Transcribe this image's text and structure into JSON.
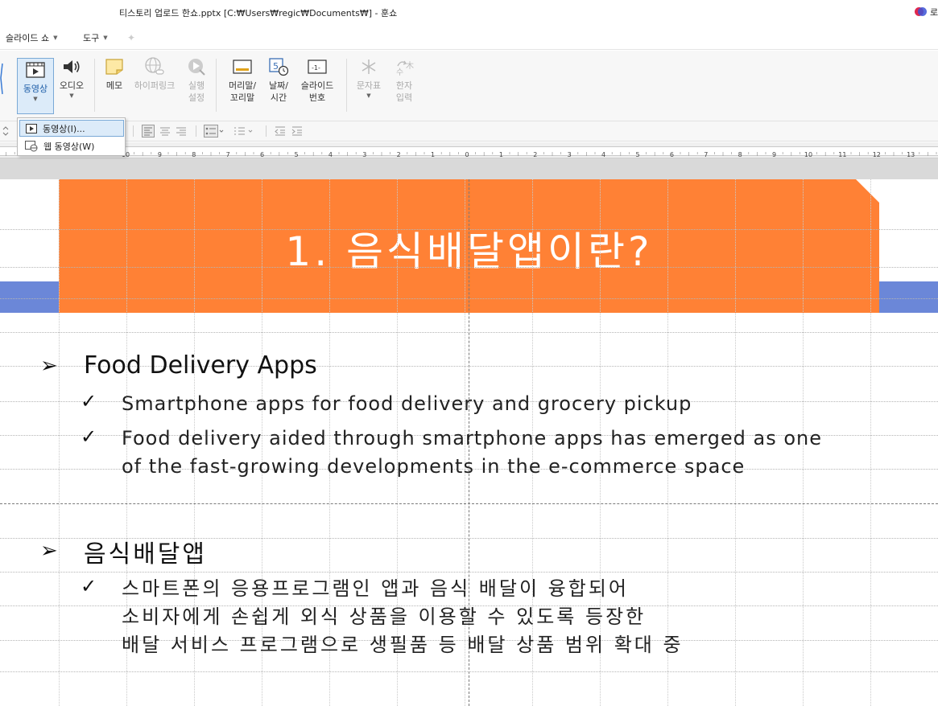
{
  "window": {
    "title": "티스토리 업로드 한쇼.pptx [C:₩Users₩regic₩Documents₩] - 훈쇼",
    "login_label": "로"
  },
  "menubar": {
    "items": [
      {
        "label": "슬라이드 쇼"
      },
      {
        "label": "도구"
      }
    ]
  },
  "ribbon": {
    "video": "동영상",
    "audio": "오디오",
    "memo": "메모",
    "hyperlink": "하이퍼링크",
    "action": "실행\n설정",
    "header_footer": "머리말/\n꼬리말",
    "date_time": "날짜/\n시간",
    "slide_number": "슬라이드\n번호",
    "symbol": "문자표",
    "hanja": "한자\n입력"
  },
  "dropdown": {
    "items": [
      {
        "label": "동영상(I)..."
      },
      {
        "label": "웹 동영상(W)"
      }
    ]
  },
  "ruler": {
    "left_labels": [
      "10",
      "9",
      "8",
      "7",
      "6",
      "5",
      "4",
      "3",
      "2",
      "1",
      "0"
    ],
    "right_labels": [
      "1",
      "2",
      "3",
      "4",
      "5",
      "6",
      "7",
      "8",
      "9",
      "10",
      "11",
      "12",
      "13"
    ]
  },
  "slide": {
    "title": "1. 음식배달앱이란?",
    "accent_orange": "#ff8135",
    "accent_blue": "#6b87d8",
    "sections": [
      {
        "heading": "Food Delivery Apps",
        "items": [
          [
            "Smartphone apps for food delivery and grocery pickup"
          ],
          [
            "Food delivery aided through smartphone apps has emerged as one",
            "of the fast-growing developments in the e-commerce space"
          ]
        ]
      },
      {
        "heading": "음식배달앱",
        "items": [
          [
            "스마트폰의 응용프로그램인 앱과 음식 배달이 융합되어",
            "소비자에게 손쉽게 외식 상품을 이용할 수 있도록 등장한",
            "배달 서비스 프로그램으로 생필품 등 배달 상품 범위 확대 중"
          ]
        ]
      }
    ]
  }
}
